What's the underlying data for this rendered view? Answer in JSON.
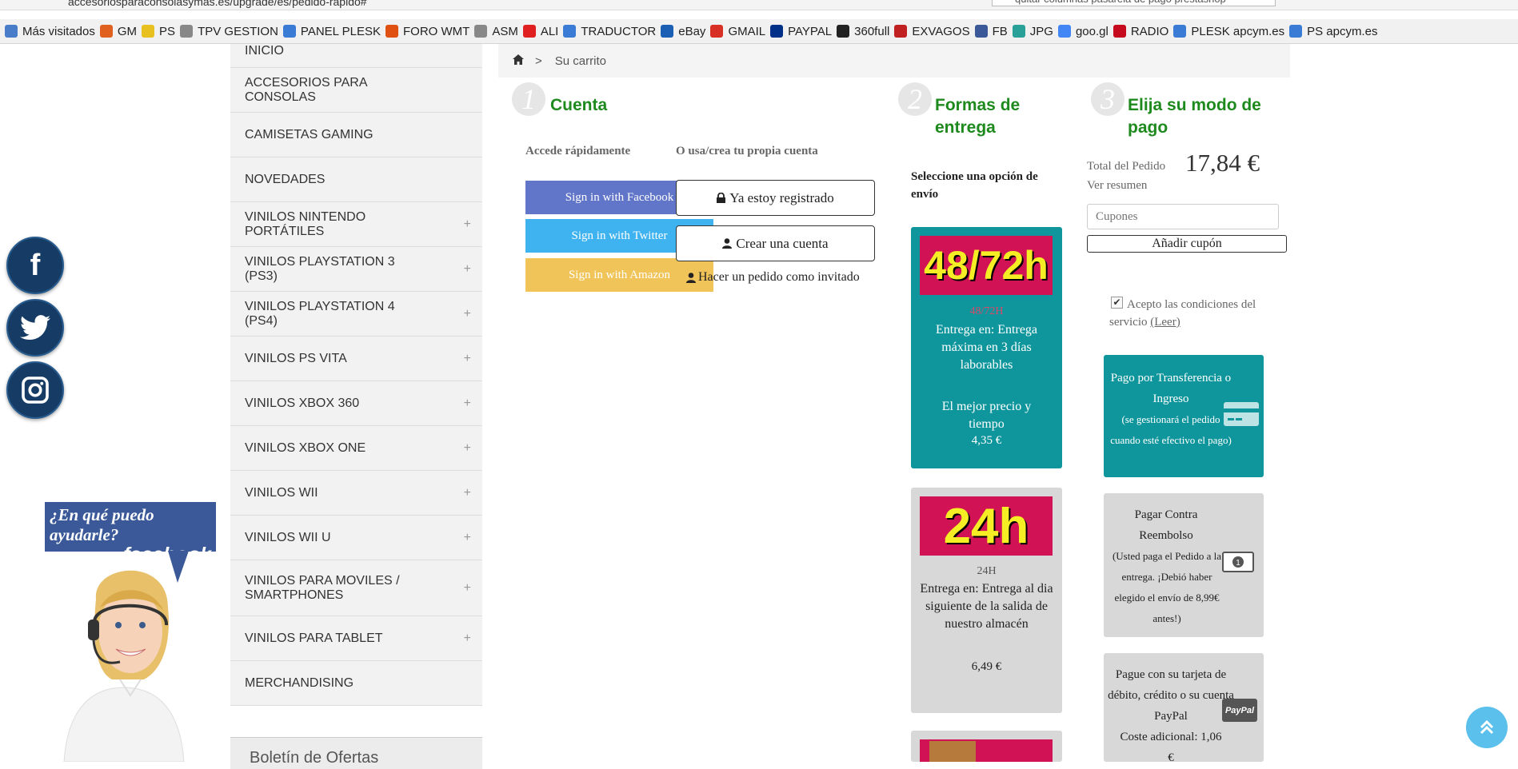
{
  "browser": {
    "url": "accesoriosparaconsolasymas.es/upgrade/es/pedido-rapido#",
    "search": "quitar columnas pasarela de pago prestashop",
    "bookmarks": [
      "Más visitados",
      "GM",
      "PS",
      "TPV GESTION",
      "PANEL PLESK",
      "FORO WMT",
      "ASM",
      "ALI",
      "TRADUCTOR",
      "eBay",
      "GMAIL",
      "PAYPAL",
      "360full",
      "EXVAGOS",
      "FB",
      "JPG",
      "goo.gl",
      "RADIO",
      "PLESK apcym.es",
      "PS apcym.es"
    ]
  },
  "sidebar": {
    "categories": [
      {
        "label": "INICIO",
        "expand": ""
      },
      {
        "label": "ACCESORIOS PARA CONSOLAS",
        "expand": ""
      },
      {
        "label": "CAMISETAS GAMING",
        "expand": ""
      },
      {
        "label": "NOVEDADES",
        "expand": ""
      },
      {
        "label": "VINILOS NINTENDO PORTÁTILES",
        "expand": "+"
      },
      {
        "label": "VINILOS PLAYSTATION 3 (PS3)",
        "expand": "+"
      },
      {
        "label": "VINILOS PLAYSTATION 4 (PS4)",
        "expand": "+"
      },
      {
        "label": "VINILOS PS VITA",
        "expand": "+"
      },
      {
        "label": "VINILOS XBOX 360",
        "expand": "+"
      },
      {
        "label": "VINILOS XBOX ONE",
        "expand": "+"
      },
      {
        "label": "VINILOS WII",
        "expand": "+"
      },
      {
        "label": "VINILOS WII U",
        "expand": "+"
      },
      {
        "label": "VINILOS PARA MOVILES / SMARTPHONES",
        "expand": "+"
      },
      {
        "label": "VINILOS PARA TABLET",
        "expand": "+"
      },
      {
        "label": "MERCHANDISING",
        "expand": ""
      }
    ],
    "newsletter": "Boletín de Ofertas"
  },
  "help": {
    "question": "¿En qué puedo ayudarle?",
    "brand": "facebook"
  },
  "breadcrumb": {
    "current": "Su carrito"
  },
  "steps": {
    "account": {
      "number": "1",
      "title": "Cuenta",
      "quick": "Accede rápidamente",
      "own": "O usa/crea tu propia cuenta",
      "facebook": "Sign in with Facebook",
      "twitter": "Sign in with Twitter",
      "amazon": "Sign in with Amazon",
      "registered": "Ya estoy registrado",
      "create": "Crear una cuenta",
      "guest": "Hacer un pedido como invitado"
    },
    "delivery": {
      "number": "2",
      "title": "Formas de entrega",
      "select": "Seleccione una opción de envío",
      "options": [
        {
          "banner": "48/72h",
          "name": "48/72H",
          "desc": "Entrega en:  Entrega máxima en 3 días laborables",
          "note": "El mejor precio y tiempo",
          "price": "4,35 €"
        },
        {
          "banner": "24h",
          "name": "24H",
          "desc": "Entrega en:  Entrega al dia siguiente de la salida de nuestro almacén",
          "note": "",
          "price": "6,49 €"
        }
      ]
    },
    "payment": {
      "number": "3",
      "title": "Elija su modo de pago",
      "total_label": "Total del Pedido",
      "total": "17,84 €",
      "summary": "Ver resumen",
      "coupon_placeholder": "Cupones",
      "coupon_button": "Añadir cupón",
      "terms": "Acepto las condiciones del servicio",
      "terms_link": "(Leer)",
      "methods": [
        {
          "title": "Pago por Transferencia o Ingreso",
          "detail": "(se gestionará el pedido cuando esté efectivo el pago)"
        },
        {
          "title": "Pagar Contra Reembolso",
          "detail": "(Usted paga el Pedido a la entrega. ¡Debió haber elegido el envío de 8,99€ antes!)"
        },
        {
          "title": "Pague con su tarjeta de débito, crédito o su cuenta PayPal",
          "detail": "Coste adicional: 1,06 €",
          "badge": "PayPal"
        }
      ]
    }
  },
  "colors": {
    "green": "#1e8a1e",
    "teal": "#0f969c",
    "grey_box": "#d8d8d8",
    "facebook": "#6176c9",
    "twitter": "#3fb2f0",
    "amazon": "#f0c458"
  }
}
